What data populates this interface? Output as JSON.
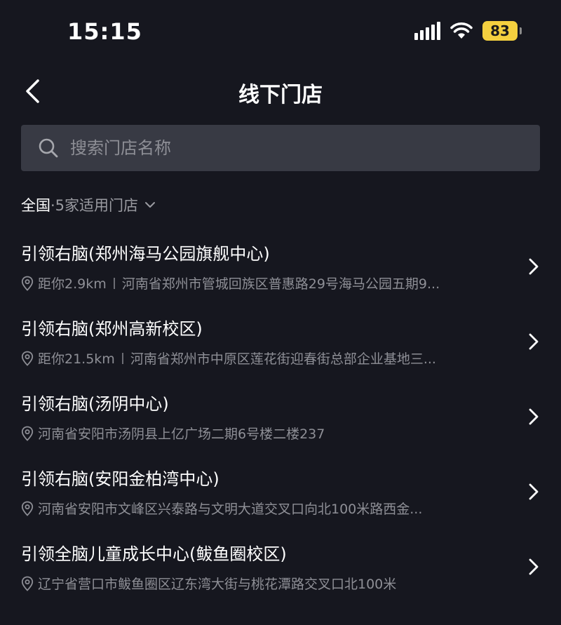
{
  "status_bar": {
    "time": "15:15",
    "battery": "83",
    "signal_icon": "signal-bars-icon",
    "wifi_icon": "wifi-icon"
  },
  "nav": {
    "title": "线下门店",
    "back_icon": "chevron-left-icon"
  },
  "search": {
    "placeholder": "搜索门店名称",
    "value": ""
  },
  "filter": {
    "region": "全国",
    "count": "·5家适用门店"
  },
  "stores": [
    {
      "name": "引领右脑(郑州海马公园旗舰中心)",
      "distance": "距你2.9km",
      "address": "河南省郑州市管城回族区普惠路29号海马公园五期9..."
    },
    {
      "name": "引领右脑(郑州高新校区)",
      "distance": "距你21.5km",
      "address": "河南省郑州市中原区莲花街迎春街总部企业基地三..."
    },
    {
      "name": "引领右脑(汤阴中心)",
      "distance": "",
      "address": "河南省安阳市汤阴县上亿广场二期6号楼二楼237"
    },
    {
      "name": "引领右脑(安阳金柏湾中心)",
      "distance": "",
      "address": "河南省安阳市文峰区兴泰路与文明大道交叉口向北100米路西金..."
    },
    {
      "name": "引领全脑儿童成长中心(鲅鱼圈校区)",
      "distance": "",
      "address": "辽宁省营口市鲅鱼圈区辽东湾大街与桃花潭路交叉口北100米"
    }
  ],
  "colors": {
    "background": "#16171f",
    "search_bg": "#383a44",
    "secondary_text": "#8e8f96",
    "battery": "#f4d03f"
  }
}
